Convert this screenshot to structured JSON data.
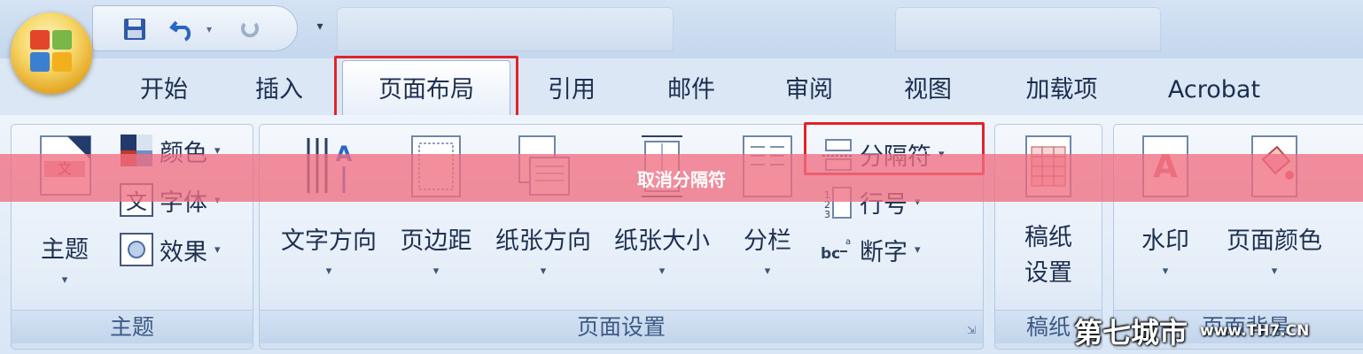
{
  "tabs": [
    {
      "id": "home",
      "label": "开始"
    },
    {
      "id": "insert",
      "label": "插入"
    },
    {
      "id": "page_layout",
      "label": "页面布局",
      "active": true
    },
    {
      "id": "references",
      "label": "引用"
    },
    {
      "id": "mailings",
      "label": "邮件"
    },
    {
      "id": "review",
      "label": "审阅"
    },
    {
      "id": "view",
      "label": "视图"
    },
    {
      "id": "addins",
      "label": "加载项"
    },
    {
      "id": "acrobat",
      "label": "Acrobat"
    }
  ],
  "groups": {
    "themes": {
      "label": "主题",
      "themes_button": "主题",
      "colors": "颜色",
      "fonts": "字体",
      "effects": "效果"
    },
    "page_setup": {
      "label": "页面设置",
      "text_direction": "文字方向",
      "margins": "页边距",
      "orientation": "纸张方向",
      "size": "纸张大小",
      "columns": "分栏",
      "breaks": "分隔符",
      "line_numbers": "行号",
      "hyphenation": "断字"
    },
    "manuscript": {
      "label": "稿纸",
      "settings_line1": "稿纸",
      "settings_line2": "设置"
    },
    "page_background": {
      "label": "页面背景",
      "watermark": "水印",
      "page_color": "页面颜色"
    }
  },
  "caption": "取消分隔符",
  "watermark": {
    "cn": "第七城市",
    "en": "www.TH7.CN"
  },
  "colors": {
    "highlight_box": "#e2232a",
    "overlay": "#f06e82"
  },
  "icons": [
    "office-button-icon",
    "save-icon",
    "undo-icon",
    "redo-icon",
    "customize-qat-icon"
  ]
}
